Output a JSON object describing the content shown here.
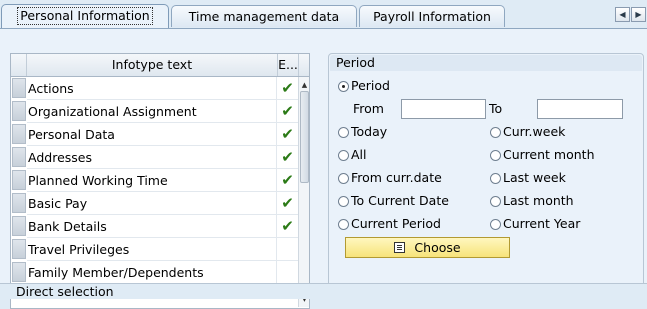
{
  "tabs": [
    {
      "label": "Personal Information",
      "active": true
    },
    {
      "label": "Time management data",
      "active": false
    },
    {
      "label": "Payroll Information",
      "active": false
    }
  ],
  "tab_nav": {
    "prev_icon": "◀",
    "next_icon": "▶"
  },
  "infotype_table": {
    "col_text": "Infotype text",
    "col_exists": "E...",
    "rows": [
      {
        "text": "Actions",
        "exists": "✔"
      },
      {
        "text": "Organizational Assignment",
        "exists": "✔"
      },
      {
        "text": "Personal Data",
        "exists": "✔"
      },
      {
        "text": "Addresses",
        "exists": "✔"
      },
      {
        "text": "Planned Working Time",
        "exists": "✔"
      },
      {
        "text": "Basic Pay",
        "exists": "✔"
      },
      {
        "text": "Bank Details",
        "exists": "✔"
      },
      {
        "text": "Travel Privileges",
        "exists": ""
      },
      {
        "text": "Family Member/Dependents",
        "exists": ""
      }
    ],
    "scroll_up": "▲",
    "scroll_down": "▼"
  },
  "period": {
    "title": "Period",
    "period_label": "Period",
    "from_label": "From",
    "from_value": "",
    "to_label": "To",
    "to_value": "",
    "left_options": [
      "Today",
      "All",
      "From curr.date",
      "To Current Date",
      "Current Period"
    ],
    "right_options": [
      "Curr.week",
      "Current month",
      "Last week",
      "Last month",
      "Current Year"
    ],
    "choose_label": "Choose"
  },
  "bottom_label": "Direct selection",
  "colors": {
    "accent_yellow": "#f7e37a",
    "check_green": "#2b7a16",
    "panel_bg": "#eaf2fa"
  }
}
